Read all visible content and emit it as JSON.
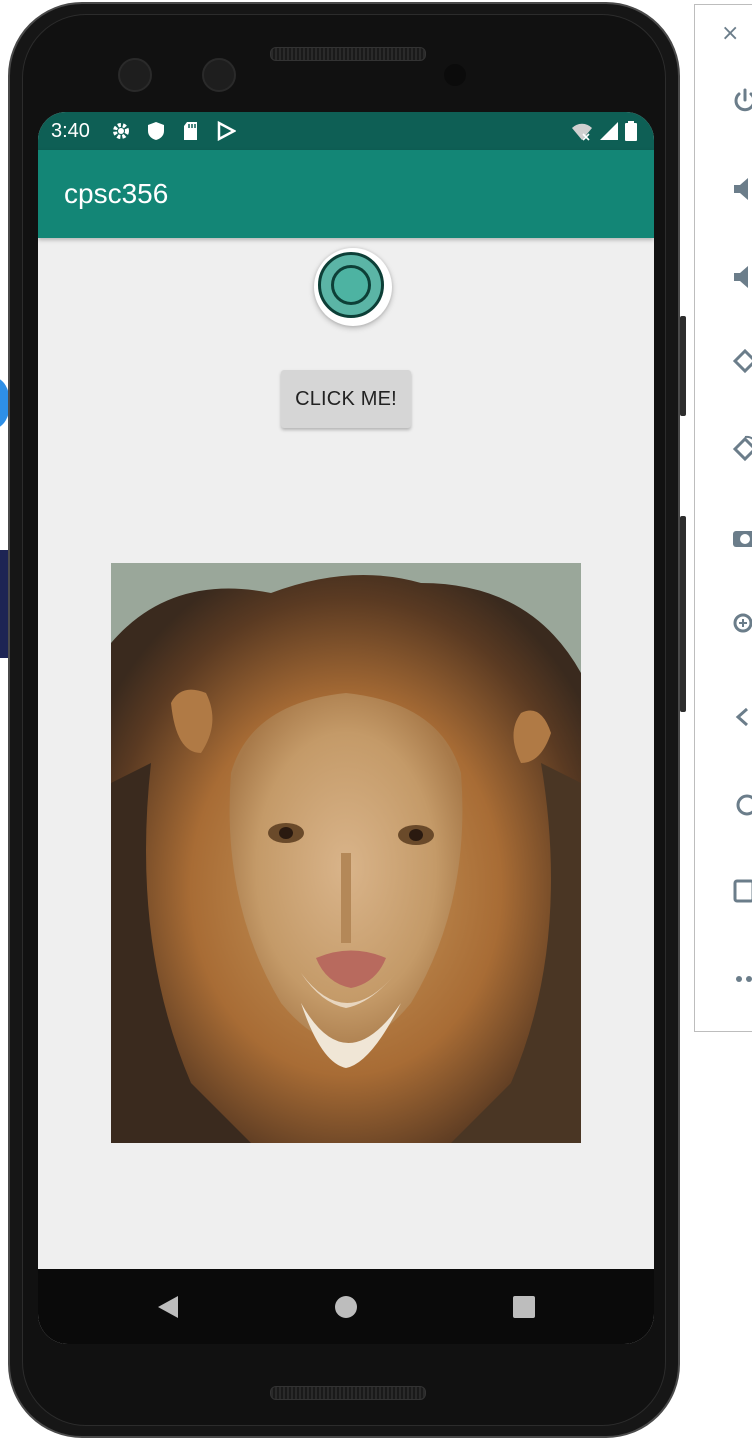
{
  "status_bar": {
    "time": "3:40"
  },
  "app_bar": {
    "title": "cpsc356"
  },
  "main": {
    "button_label": "CLICK ME!"
  },
  "icons": {
    "status": [
      "gear-icon",
      "shield-icon",
      "sd-card-icon",
      "play-protect-icon",
      "wifi-icon",
      "signal-icon",
      "battery-icon"
    ],
    "nav": [
      "back-icon",
      "home-icon",
      "recents-icon"
    ],
    "toolbar": [
      "close-icon",
      "power-icon",
      "volume-up-icon",
      "volume-down-icon",
      "rotate-left-icon",
      "rotate-right-icon",
      "camera-icon",
      "zoom-icon",
      "back-icon",
      "home-icon",
      "overview-icon",
      "more-icon"
    ]
  },
  "colors": {
    "status_bar": "#0e5f55",
    "app_bar": "#138676",
    "radio_accent": "#4db3a2"
  }
}
